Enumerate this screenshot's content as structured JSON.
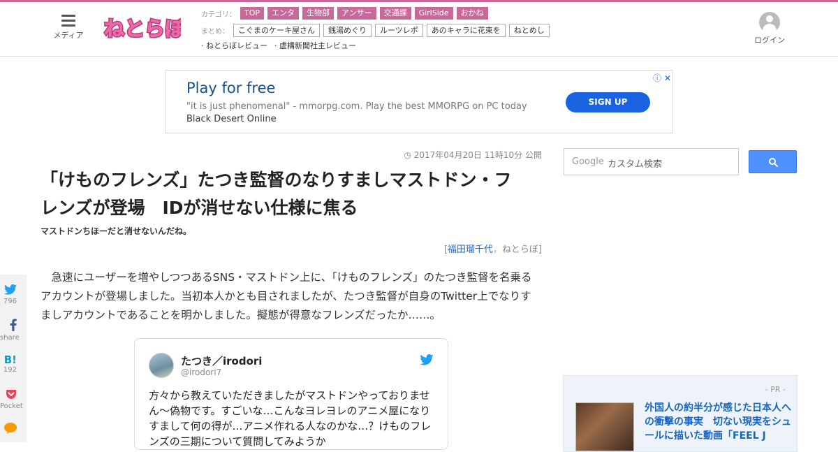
{
  "header": {
    "menu_label": "メディア",
    "category_label": "カテゴリ：",
    "categories": [
      "TOP",
      "エンタ",
      "生物部",
      "アンサー",
      "交通課",
      "GirlSide",
      "おかね"
    ],
    "matome_label": "まとめ：",
    "matome": [
      "こぐまのケーキ屋さん",
      "銭湯めぐり",
      "ルーツレポ",
      "あのキャラに花束を",
      "ねとめし"
    ],
    "reviews": [
      "· ねとらぼレビュー",
      "· 虚構新聞社主レビュー"
    ],
    "login_label": "ログイン",
    "brand_color": "#c76a9a"
  },
  "ad": {
    "title": "Play for free",
    "desc": "\"it is just phenomenal\" - mmorpg.com. Play the best MMORPG on PC today",
    "desc_strong": "Black Desert Online",
    "cta": "SIGN UP",
    "icons": "ⓘ ✕"
  },
  "article": {
    "date": "2017年04月20日 11時10分 公開",
    "title": "「けものフレンズ」たつき監督のなりすましマストドン・フレンズが登場　IDが消せない仕様に焦る",
    "subtitle": "マストドンちほーだと消せないんだね。",
    "byline_open": "[",
    "author": "福田瑠千代",
    "byline_sep": "，",
    "outlet": "ねとらぼ]",
    "lead": "急速にユーザーを増やしつつあるSNS・マストドン上に、「けものフレンズ」のたつき監督を名乗るアカウントが登場しました。当初本人かとも目されましたが、たつき監督が自身のTwitter上でなりすましアカウントであることを明かしました。擬態が得意なフレンズだったか……。"
  },
  "tweet": {
    "name": "たつき／irodori",
    "handle": "@irodori7",
    "body": "方々から教えていただきましたがマストドンやっておりません～偽物です。すごいな…こんなヨレヨレのアニメ屋になりすまして何の得が…アニメ作れる人なのかな…？けものフレンズの三期について質問してみようか"
  },
  "share": [
    {
      "icon": "twitter-icon",
      "count": "796"
    },
    {
      "icon": "facebook-icon",
      "count": "share"
    },
    {
      "icon": "hatena-icon",
      "count": "192"
    },
    {
      "icon": "pocket-icon",
      "count": "Pocket"
    },
    {
      "icon": "line-icon",
      "count": ""
    }
  ],
  "search": {
    "logo": "Google",
    "placeholder": "カスタム検索"
  },
  "pr": {
    "label": "- PR -",
    "text": "外国人の約半分が感じた日本人への衝撃の事実　切ない現実をシュールに描いた動画「FEEL J"
  }
}
